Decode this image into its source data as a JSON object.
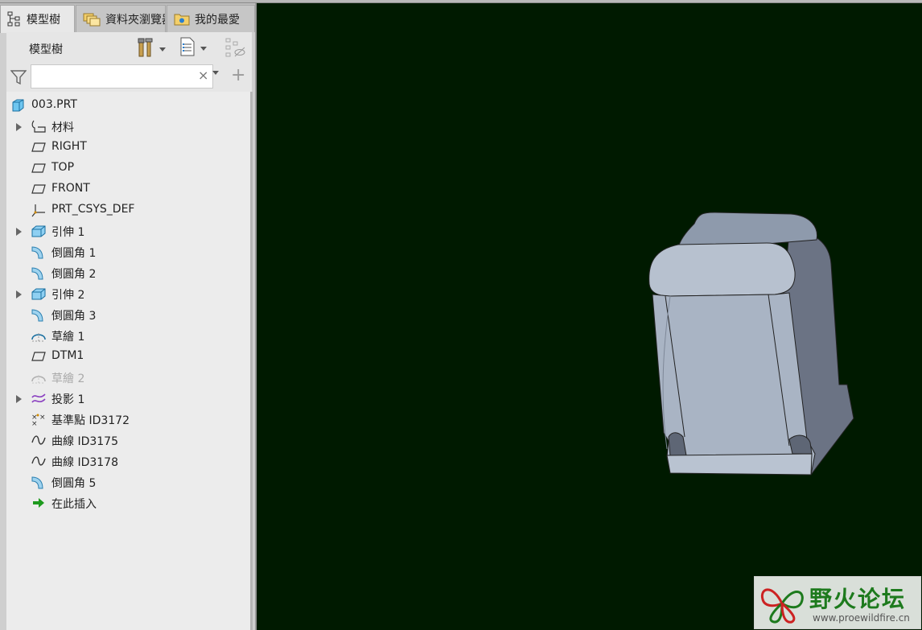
{
  "tabs": [
    {
      "label": "模型樹",
      "icon": "tree-structure-icon",
      "active": true
    },
    {
      "label": "資料夾瀏覽器",
      "icon": "folder-browser-icon",
      "active": false
    },
    {
      "label": "我的最愛",
      "icon": "favorites-icon",
      "active": false
    }
  ],
  "toolbar": {
    "title": "模型樹",
    "settings_icon": "tools-icon",
    "show_icon": "list-settings-icon",
    "hide_icon": "visibility-icon"
  },
  "filter": {
    "placeholder": "",
    "value": "",
    "clear": "×",
    "add": "+"
  },
  "tree": {
    "root": {
      "label": "003.PRT",
      "icon": "part-icon"
    },
    "items": [
      {
        "label": "材料",
        "icon": "material-icon",
        "expandable": true
      },
      {
        "label": "RIGHT",
        "icon": "datum-plane-icon",
        "expandable": false
      },
      {
        "label": "TOP",
        "icon": "datum-plane-icon",
        "expandable": false
      },
      {
        "label": "FRONT",
        "icon": "datum-plane-icon",
        "expandable": false
      },
      {
        "label": "PRT_CSYS_DEF",
        "icon": "coordinate-system-icon",
        "expandable": false
      },
      {
        "label": "引伸 1",
        "icon": "extrude-icon",
        "expandable": true
      },
      {
        "label": "倒圓角 1",
        "icon": "round-icon",
        "expandable": false
      },
      {
        "label": "倒圓角 2",
        "icon": "round-icon",
        "expandable": false
      },
      {
        "label": "引伸 2",
        "icon": "extrude-icon",
        "expandable": true
      },
      {
        "label": "倒圓角 3",
        "icon": "round-icon",
        "expandable": false
      },
      {
        "label": "草繪 1",
        "icon": "sketch-icon",
        "expandable": false
      },
      {
        "label": "DTM1",
        "icon": "datum-plane-icon",
        "expandable": false
      },
      {
        "label": "草繪 2",
        "icon": "sketch-icon",
        "expandable": false,
        "dimmed": true
      },
      {
        "label": "投影 1",
        "icon": "projection-icon",
        "expandable": true
      },
      {
        "label": "基準點 ID3172",
        "icon": "datum-point-icon",
        "expandable": false
      },
      {
        "label": "曲線 ID3175",
        "icon": "curve-icon",
        "expandable": false
      },
      {
        "label": "曲線 ID3178",
        "icon": "curve-icon",
        "expandable": false
      },
      {
        "label": "倒圓角 5",
        "icon": "round-icon",
        "expandable": false
      },
      {
        "label": "在此插入",
        "icon": "insert-here-arrow-icon",
        "expandable": false
      }
    ]
  },
  "watermark": {
    "title": "野火论坛",
    "url": "www.proewildfire.cn"
  },
  "colors": {
    "viewport_bg": "#001a00",
    "model": "#a9b4c4",
    "watermark_green": "#1d7a1d"
  }
}
